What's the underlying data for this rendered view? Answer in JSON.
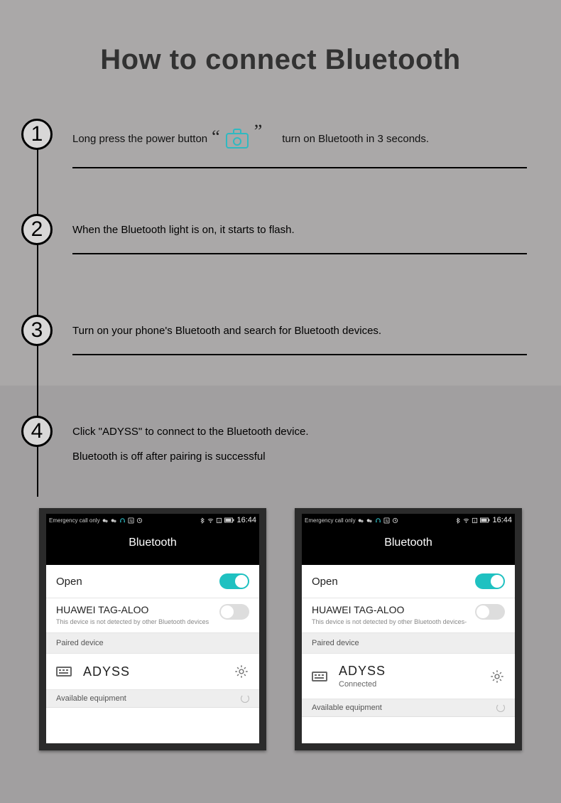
{
  "title": "How to connect Bluetooth",
  "steps": {
    "s1": {
      "num": "1",
      "pre": "Long press the power button",
      "post": "turn on Bluetooth in 3 seconds."
    },
    "s2": {
      "num": "2",
      "text": "When the Bluetooth light is on, it starts to flash."
    },
    "s3": {
      "num": "3",
      "text": "Turn on your phone's Bluetooth and search for Bluetooth devices."
    },
    "s4": {
      "num": "4",
      "text_a": "Click \"ADYSS\" to connect to the Bluetooth device.",
      "text_b": "Bluetooth is off after pairing is successful"
    }
  },
  "phone": {
    "status_left": "Emergency call only",
    "time": "16:44",
    "title": "Bluetooth",
    "open": "Open",
    "device_name": "HUAWEI TAG-ALOO",
    "device_sub_a": "This device is not detected by other Bluetooth devices",
    "device_sub_b": "This device is not detected by other Bluetooth devices-",
    "paired_header": "Paired device",
    "paired_name": "ADYSS",
    "connected": "Connected",
    "available": "Available equipment"
  }
}
